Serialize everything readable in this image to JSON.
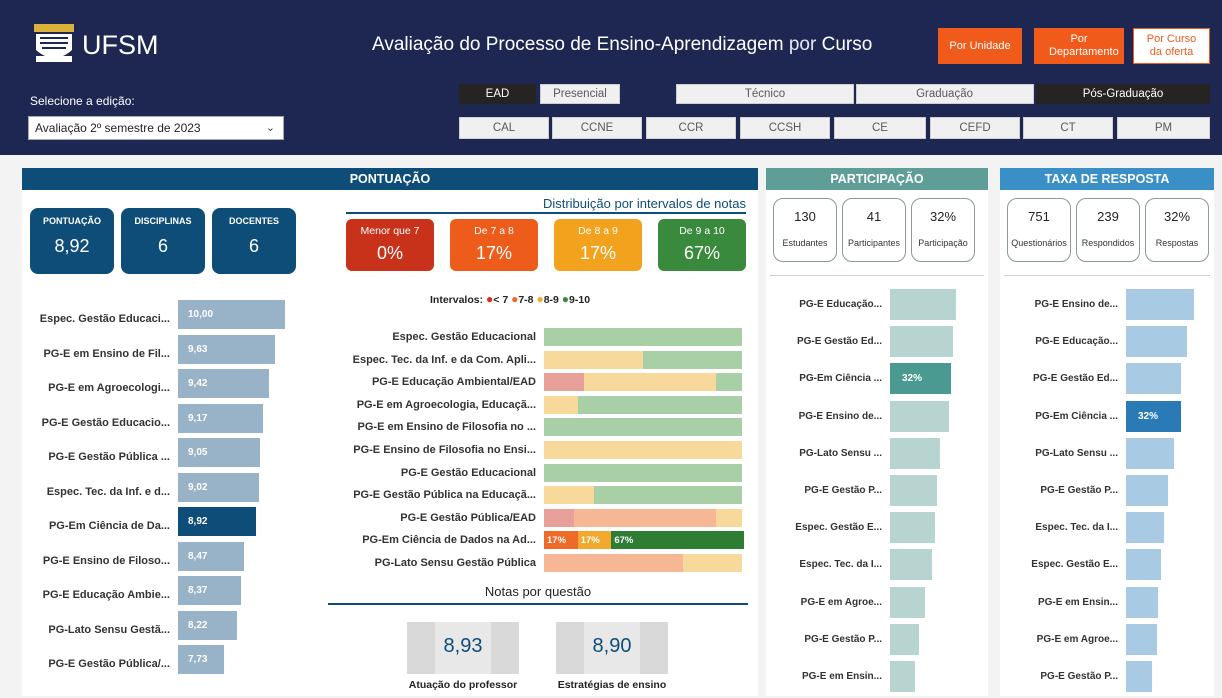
{
  "header": {
    "logo_text": "UFSM",
    "title_parts": [
      "Avaliação do Processo de Ensino-Aprendizagem",
      " por ",
      "Curso"
    ],
    "buttons": {
      "por_unidade": "Por Unidade",
      "por_departamento": "Por Departamento",
      "por_curso": "Por Curso da oferta"
    },
    "edition_label": "Selecione a edição:",
    "edition_value": "Avaliação 2º semestre de 2023"
  },
  "filters": {
    "modalidade": [
      "EAD",
      "Presencial"
    ],
    "nivel": [
      "Técnico",
      "Graduação",
      "Pós-Graduação"
    ],
    "unidades": [
      "CAL",
      "CCNE",
      "CCR",
      "CCSH",
      "CE",
      "CEFD",
      "CT",
      "PM"
    ]
  },
  "pontuacao": {
    "title": "PONTUAÇÃO",
    "kpis": [
      {
        "label": "PONTUAÇÃO",
        "value": "8,92"
      },
      {
        "label": "DISCIPLINAS",
        "value": "6"
      },
      {
        "label": "DOCENTES",
        "value": "6"
      }
    ],
    "dist_title": "Distribuição por intervalos de notas",
    "dist": [
      {
        "label": "Menor que 7",
        "value": "0%",
        "color": "#c8321b"
      },
      {
        "label": "De 7 a 8",
        "value": "17%",
        "color": "#ee5c1b"
      },
      {
        "label": "De 8 a 9",
        "value": "17%",
        "color": "#f2a21c"
      },
      {
        "label": "De 9 a 10",
        "value": "67%",
        "color": "#3a8a3e"
      }
    ],
    "legend_prefix": "Intervalos:",
    "legend": [
      "< 7",
      "7-8",
      "8-9",
      "9-10"
    ],
    "legend_colors": [
      "#d3311b",
      "#ef6a28",
      "#f3a92e",
      "#3a8a3e"
    ],
    "ranking": [
      {
        "label": "Espec. Gestão Educaci...",
        "value": "10,00",
        "score": 10.0
      },
      {
        "label": "PG-E em Ensino de Fil...",
        "value": "9,63",
        "score": 9.63
      },
      {
        "label": "PG-E em Agroecologi...",
        "value": "9,42",
        "score": 9.42
      },
      {
        "label": "PG-E Gestão Educacio...",
        "value": "9,17",
        "score": 9.17
      },
      {
        "label": "PG-E Gestão Pública ...",
        "value": "9,05",
        "score": 9.05
      },
      {
        "label": "Espec. Tec. da Inf. e d...",
        "value": "9,02",
        "score": 9.02
      },
      {
        "label": "PG-Em Ciência de Da...",
        "value": "8,92",
        "score": 8.92,
        "highlight": true
      },
      {
        "label": "PG-E Ensino de Filoso...",
        "value": "8,47",
        "score": 8.47
      },
      {
        "label": "PG-E Educação Ambie...",
        "value": "8,37",
        "score": 8.37
      },
      {
        "label": "PG-Lato Sensu Gestã...",
        "value": "8,22",
        "score": 8.22
      },
      {
        "label": "PG-E Gestão Pública/...",
        "value": "7,73",
        "score": 7.73
      }
    ],
    "stacked": [
      {
        "label": "Espec. Gestão Educacional",
        "parts": [
          0,
          0,
          0,
          100
        ]
      },
      {
        "label": "Espec. Tec. da Inf. e da Com. Apli...",
        "parts": [
          0,
          0,
          50,
          50
        ]
      },
      {
        "label": "PG-E Educação Ambiental/EAD",
        "parts": [
          20,
          0,
          67,
          13
        ]
      },
      {
        "label": "PG-E em Agroecologia, Educaçã...",
        "parts": [
          0,
          0,
          17,
          83
        ]
      },
      {
        "label": "PG-E em Ensino de Filosofia no ...",
        "parts": [
          0,
          0,
          0,
          100
        ]
      },
      {
        "label": "PG-E Ensino de Filosofia no Ensi...",
        "parts": [
          0,
          0,
          100,
          0
        ]
      },
      {
        "label": "PG-E Gestão Educacional",
        "parts": [
          0,
          0,
          0,
          100
        ]
      },
      {
        "label": "PG-E Gestão Pública na Educaçã...",
        "parts": [
          0,
          0,
          25,
          75
        ]
      },
      {
        "label": "PG-E Gestão Pública/EAD",
        "parts": [
          15,
          72,
          13,
          0
        ]
      },
      {
        "label": "PG-Em Ciência de Dados na Ad...",
        "parts": [
          0,
          17,
          17,
          67
        ],
        "highlight": true,
        "labels": [
          "",
          "17%",
          "17%",
          "67%"
        ]
      },
      {
        "label": "PG-Lato Sensu Gestão Pública",
        "parts": [
          0,
          70,
          30,
          0
        ]
      }
    ],
    "stack_colors": [
      "#e8a09a",
      "#f6b894",
      "#f7d99b",
      "#a9cfa7"
    ],
    "stack_colors_hl": [
      "#d3311b",
      "#ef6a28",
      "#f3a92e",
      "#2e7d32"
    ],
    "notas_title": "Notas por questão",
    "notas": [
      {
        "label": "Atuação do professor",
        "value": "8,93"
      },
      {
        "label": "Estratégias de ensino",
        "value": "8,90"
      }
    ]
  },
  "participacao": {
    "title": "PARTICIPAÇÃO",
    "cards": [
      {
        "value": "130",
        "label": "Estudantes"
      },
      {
        "value": "41",
        "label": "Participantes"
      },
      {
        "value": "32%",
        "label": "Participação"
      }
    ],
    "ranking": [
      {
        "label": "PG-E Educação...",
        "level": 0.92
      },
      {
        "label": "PG-E Gestão Ed...",
        "level": 0.87
      },
      {
        "label": "PG-Em Ciência ...",
        "level": 0.85,
        "highlight": true,
        "value": "32%"
      },
      {
        "label": "PG-E Ensino de...",
        "level": 0.82
      },
      {
        "label": "PG-Lato Sensu ...",
        "level": 0.69
      },
      {
        "label": "PG-E Gestão P...",
        "level": 0.65
      },
      {
        "label": "Espec. Gestão E...",
        "level": 0.63
      },
      {
        "label": "Espec. Tec. da I...",
        "level": 0.58
      },
      {
        "label": "PG-E em Agroe...",
        "level": 0.48
      },
      {
        "label": "PG-E Gestão P...",
        "level": 0.4
      },
      {
        "label": "PG-E em Ensin...",
        "level": 0.35
      }
    ]
  },
  "taxa": {
    "title": "TAXA DE RESPOSTA",
    "cards": [
      {
        "value": "751",
        "label": "Questionários"
      },
      {
        "value": "239",
        "label": "Respondidos"
      },
      {
        "value": "32%",
        "label": "Respostas"
      }
    ],
    "ranking": [
      {
        "label": "PG-E Ensino de...",
        "level": 0.94
      },
      {
        "label": "PG-E Educação...",
        "level": 0.85
      },
      {
        "label": "PG-E Gestão Ed...",
        "level": 0.77
      },
      {
        "label": "PG-Em Ciência ...",
        "level": 0.77,
        "highlight": true,
        "value": "32%"
      },
      {
        "label": "PG-Lato Sensu ...",
        "level": 0.67
      },
      {
        "label": "PG-E Gestão P...",
        "level": 0.58
      },
      {
        "label": "Espec. Tec. da I...",
        "level": 0.53
      },
      {
        "label": "Espec. Gestão E...",
        "level": 0.48
      },
      {
        "label": "PG-E em Ensin...",
        "level": 0.45
      },
      {
        "label": "PG-E em Agroe...",
        "level": 0.43
      },
      {
        "label": "PG-E Gestão P...",
        "level": 0.36
      }
    ]
  },
  "colors": {
    "header": "#1e2752",
    "accent": "#f05a1a",
    "pontuacao": "#0f4d79",
    "participacao": "#5e9e96",
    "taxa": "#3a8fc6"
  }
}
